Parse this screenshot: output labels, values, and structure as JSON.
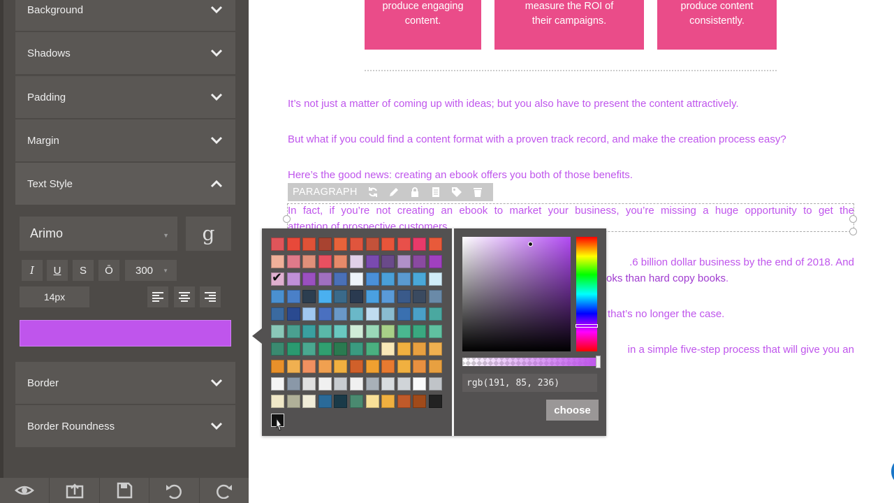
{
  "sidebar": {
    "sections": [
      {
        "label": "Background",
        "state": "collapsed"
      },
      {
        "label": "Shadows",
        "state": "collapsed"
      },
      {
        "label": "Padding",
        "state": "collapsed"
      },
      {
        "label": "Margin",
        "state": "collapsed"
      },
      {
        "label": "Text Style",
        "state": "expanded"
      },
      {
        "label": "Border",
        "state": "collapsed"
      },
      {
        "label": "Border Roundness",
        "state": "collapsed"
      }
    ],
    "text_style": {
      "font_family": "Arimo",
      "google_fonts_glyph": "g",
      "format_buttons": [
        "I",
        "U",
        "S",
        "Ō"
      ],
      "font_weight": "300",
      "font_size": "14px",
      "align_buttons": [
        "align-left",
        "align-center",
        "align-right"
      ],
      "text_color": "#bf55ec"
    },
    "bottom_toolbar": [
      "eye-icon",
      "export-icon",
      "save-icon",
      "undo-icon",
      "redo-icon"
    ]
  },
  "content": {
    "cards": [
      {
        "line1": "produce engaging",
        "line2": "content."
      },
      {
        "line1": "measure the ROI of",
        "line2": "their campaigns."
      },
      {
        "line1": "produce content",
        "line2": "consistently."
      }
    ],
    "paragraphs": [
      "It’s not just a matter of coming up with ideas; but you also have to present the content attractively.",
      "But what if you could find a content format with a proven track record, and make the creation process easy?",
      "Here’s the good news: creating an ebook offers you both of those benefits."
    ],
    "selected_paragraph": {
      "line1": "In fact, if you’re not creating an ebook to market your business, you’re missing a huge opportunity to get the",
      "line2": "attention of prospective customers."
    },
    "partial_lines": {
      "p5_line1": ".6 billion dollar business by the end of 2018. And",
      "p5_line2": "oks than hard copy books",
      "p5_line2_end": ".",
      "p6_line1": "that’s no longer the case.",
      "p7_line1": "in a simple five-step process that will give you an"
    },
    "toolbar": {
      "label": "PARAGRAPH",
      "icons": [
        "refresh-icon",
        "pencil-icon",
        "lock-icon",
        "document-icon",
        "tag-icon",
        "trash-icon"
      ]
    }
  },
  "color_picker": {
    "swatches": [
      [
        "#e0555a",
        "#e8493a",
        "#e05237",
        "#a84330",
        "#e8633a",
        "#e0553d",
        "#c4523a",
        "#e8553a",
        "#e8504a",
        "#e83a6a",
        "#e85a3a"
      ],
      [
        "#f0b09a",
        "#e07a8a",
        "#e0907a",
        "#e85060",
        "#e88a6a",
        "#e0d0e8",
        "#7a4ab0",
        "#6a4a8a",
        "#b090c8",
        "#8a4aa0",
        "#a040c0"
      ],
      [
        "#e0b0d0",
        "#c090d8",
        "#9a50c0",
        "#a070c0",
        "#4a70b8",
        "#eef4fa",
        "#4a90d8",
        "#4aa0d8",
        "#5a9ad0",
        "#4aa8d8",
        "#d0ecf8"
      ],
      [
        "#4a90d0",
        "#4a80c8",
        "#2c3e50",
        "#4ab0f0",
        "#3a6a8a",
        "#2a3a50",
        "#4aa0e0",
        "#5a9ad8",
        "#3a5a8a",
        "#3a4a60",
        "#6a8aa8"
      ],
      [
        "#3a6aa0",
        "#2a4a90",
        "#a0c8f0",
        "#4a70c0",
        "#6a98c8",
        "#6ab8c8",
        "#c0dcf0",
        "#8abcd0",
        "#3a70b0",
        "#4aa0c8",
        "#4aa8a0"
      ],
      [
        "#8ac8b8",
        "#4aa090",
        "#3aa0a0",
        "#5ab8a8",
        "#6ac8c0",
        "#d0ecd8",
        "#9ad8b8",
        "#a8d088",
        "#4ab890",
        "#3aa880",
        "#60c0a0"
      ],
      [
        "#3a8a70",
        "#2a9a70",
        "#4aa890",
        "#30a070",
        "#2a7a50",
        "#3a9a80",
        "#4ab080",
        "#f8e8b8",
        "#f0b040",
        "#e8a040",
        "#f0b050"
      ],
      [
        "#e8902a",
        "#f0b050",
        "#f09060",
        "#f0a050",
        "#f0b040",
        "#d0602a",
        "#f0a030",
        "#e87a30",
        "#f0b040",
        "#e89040",
        "#e8a040"
      ],
      [
        "#f4f4f4",
        "#8a98a8",
        "#e0e0e0",
        "#f0f0f0",
        "#c8ccd0",
        "#f0f0f0",
        "#a8b0b8",
        "#d8dcdf",
        "#d0d4d8",
        "#fafafa",
        "#c0c4c8"
      ],
      [
        "#f0e8c8",
        "#b0b098",
        "#f0ecd8",
        "#2a6a98",
        "#1a3a48",
        "#4a8a70",
        "#f8e098",
        "#f0b040",
        "#c05a2a",
        "#a04a1a",
        "#222222"
      ]
    ],
    "selected_swatch": {
      "row": 2,
      "col": 0
    },
    "rgb_value": "rgb(191, 85, 236)",
    "choose_label": "choose"
  }
}
